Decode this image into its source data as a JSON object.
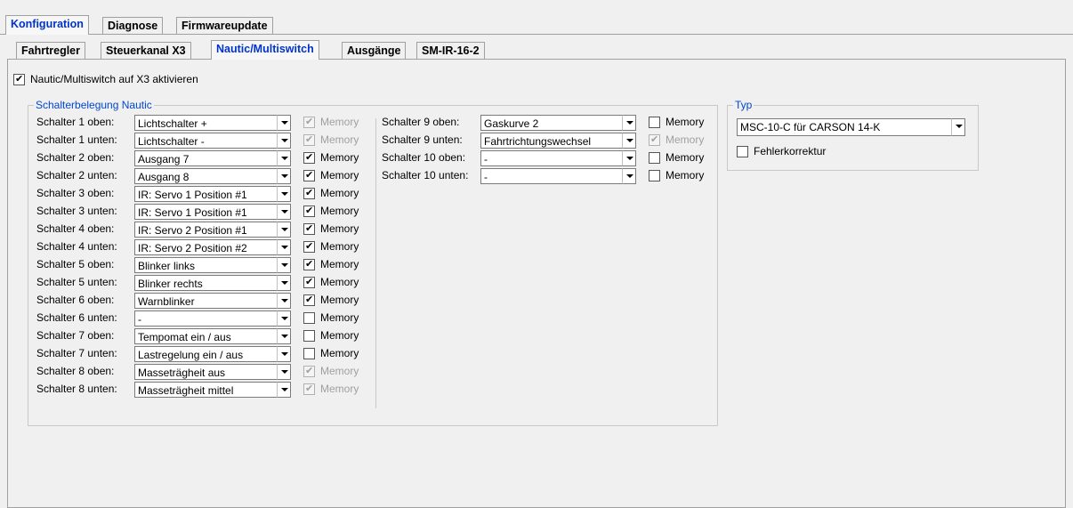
{
  "main_tabs": [
    "Konfiguration",
    "Diagnose",
    "Firmwareupdate"
  ],
  "sub_tabs": [
    "Fahrtregler",
    "Steuerkanal X3",
    "Nautic/Multiswitch",
    "Ausgänge",
    "SM-IR-16-2"
  ],
  "activate_checkbox": {
    "label": "Nautic/Multiswitch auf X3 aktivieren",
    "checked": true
  },
  "group_nautic": {
    "title": "Schalterbelegung Nautic"
  },
  "memory_label": "Memory",
  "switches_col1": [
    {
      "label": "Schalter 1 oben:",
      "value": "Lichtschalter +",
      "memory": true,
      "memory_enabled": false
    },
    {
      "label": "Schalter 1 unten:",
      "value": "Lichtschalter -",
      "memory": true,
      "memory_enabled": false
    },
    {
      "label": "Schalter 2 oben:",
      "value": "Ausgang 7",
      "memory": true,
      "memory_enabled": true
    },
    {
      "label": "Schalter 2 unten:",
      "value": "Ausgang 8",
      "memory": true,
      "memory_enabled": true
    },
    {
      "label": "Schalter 3 oben:",
      "value": "IR: Servo 1 Position #1",
      "memory": true,
      "memory_enabled": true
    },
    {
      "label": "Schalter 3 unten:",
      "value": "IR: Servo 1 Position #1",
      "memory": true,
      "memory_enabled": true
    },
    {
      "label": "Schalter 4 oben:",
      "value": "IR: Servo 2 Position #1",
      "memory": true,
      "memory_enabled": true
    },
    {
      "label": "Schalter 4 unten:",
      "value": "IR: Servo 2 Position #2",
      "memory": true,
      "memory_enabled": true
    },
    {
      "label": "Schalter 5 oben:",
      "value": "Blinker links",
      "memory": true,
      "memory_enabled": true
    },
    {
      "label": "Schalter 5 unten:",
      "value": "Blinker rechts",
      "memory": true,
      "memory_enabled": true
    },
    {
      "label": "Schalter 6 oben:",
      "value": "Warnblinker",
      "memory": true,
      "memory_enabled": true
    },
    {
      "label": "Schalter 6 unten:",
      "value": "-",
      "memory": false,
      "memory_enabled": true
    },
    {
      "label": "Schalter 7 oben:",
      "value": "Tempomat ein / aus",
      "memory": false,
      "memory_enabled": true
    },
    {
      "label": "Schalter 7 unten:",
      "value": "Lastregelung ein / aus",
      "memory": false,
      "memory_enabled": true
    },
    {
      "label": "Schalter 8 oben:",
      "value": "Masseträgheit aus",
      "memory": true,
      "memory_enabled": false
    },
    {
      "label": "Schalter 8 unten:",
      "value": "Masseträgheit mittel",
      "memory": true,
      "memory_enabled": false
    }
  ],
  "switches_col2": [
    {
      "label": "Schalter 9 oben:",
      "value": "Gaskurve 2",
      "memory": false,
      "memory_enabled": true
    },
    {
      "label": "Schalter 9 unten:",
      "value": "Fahrtrichtungswechsel",
      "memory": true,
      "memory_enabled": false
    },
    {
      "label": "Schalter 10 oben:",
      "value": "-",
      "memory": false,
      "memory_enabled": true
    },
    {
      "label": "Schalter 10 unten:",
      "value": "-",
      "memory": false,
      "memory_enabled": true
    }
  ],
  "group_typ": {
    "title": "Typ",
    "select_value": "MSC-10-C für CARSON 14-K",
    "error_correction_label": "Fehlerkorrektur",
    "error_correction_checked": false
  }
}
